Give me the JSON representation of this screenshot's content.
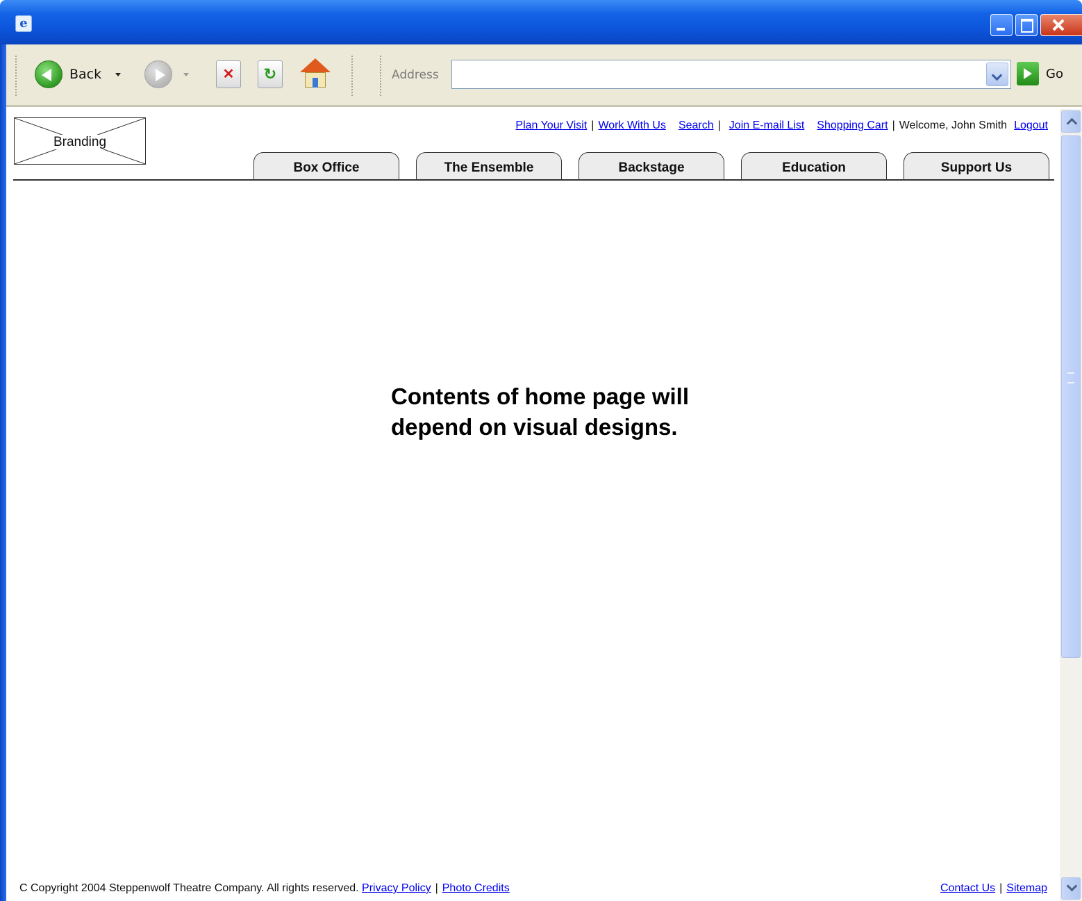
{
  "browser": {
    "back_label": "Back",
    "address_label": "Address",
    "address_value": "",
    "go_label": "Go"
  },
  "site": {
    "branding_label": "Branding",
    "utility_links": {
      "plan_your_visit": "Plan Your Visit",
      "work_with_us": "Work With Us",
      "search": "Search",
      "join_email_list": "Join E-mail List",
      "shopping_cart": "Shopping Cart",
      "welcome_text": "Welcome, John Smith",
      "logout": "Logout"
    },
    "tabs": [
      "Box Office",
      "The Ensemble",
      "Backstage",
      "Education",
      "Support Us"
    ],
    "main_message_line1": "Contents of home page will",
    "main_message_line2": "depend on visual designs.",
    "footer": {
      "copyright": "C Copyright 2004 Steppenwolf Theatre Company. All rights reserved.",
      "privacy_policy": "Privacy Policy",
      "photo_credits": "Photo Credits",
      "contact_us": "Contact Us",
      "sitemap": "Sitemap"
    }
  },
  "icons": {
    "app": "ie-window-icon",
    "back": "back-arrow-icon",
    "forward": "forward-arrow-icon",
    "stop": "stop-icon",
    "refresh": "refresh-icon",
    "home": "home-icon",
    "go": "go-arrow-icon"
  },
  "colors": {
    "titlebar": "#0b53d8",
    "toolbar": "#ece9d8",
    "link": "#0000ee",
    "tab_fill": "#ececec"
  }
}
